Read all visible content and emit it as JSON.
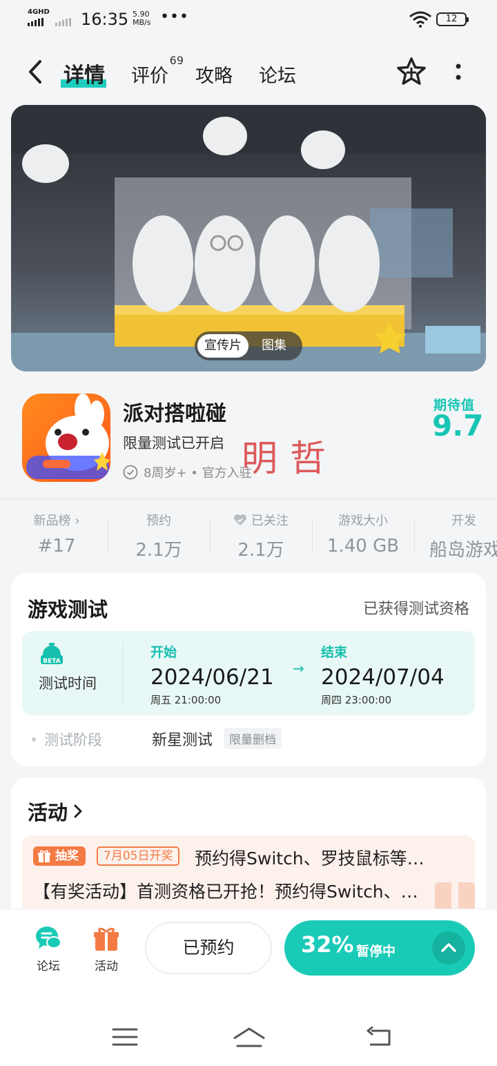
{
  "status_bar": {
    "network": "4GHD",
    "time": "16:35",
    "speed_value": "5.90",
    "speed_unit": "MB/s",
    "dots": "•••",
    "battery": "12"
  },
  "header": {
    "tabs": [
      {
        "label": "详情",
        "active": true
      },
      {
        "label": "评价",
        "badge": "69"
      },
      {
        "label": "攻略"
      },
      {
        "label": "论坛"
      }
    ]
  },
  "banner": {
    "toggle": [
      "宣传片",
      "图集"
    ]
  },
  "app": {
    "name": "派对搭啦碰",
    "subtitle": "限量测试已开启",
    "meta": "8周岁+ • 官方入驻",
    "stamp_text": "明哲",
    "expect_label": "期待值",
    "expect_value": "9.7"
  },
  "stats": [
    {
      "label": "新品榜 ›",
      "value": "#17"
    },
    {
      "label": "预约",
      "value": "2.1万"
    },
    {
      "label": "已关注",
      "value": "2.1万"
    },
    {
      "label": "游戏大小",
      "value": "1.40 GB"
    },
    {
      "label": "开发",
      "value": "船岛游戏"
    }
  ],
  "test": {
    "title": "游戏测试",
    "right": "已获得测试资格",
    "time_label": "测试时间",
    "beta": "BETA",
    "start_label": "开始",
    "start_date": "2024/06/21",
    "start_weekday": "周五  21:00:00",
    "end_label": "结束",
    "end_date": "2024/07/04",
    "end_weekday": "周四  23:00:00",
    "arrow": "→",
    "phase_label": "测试阶段",
    "phase_value": "新星测试",
    "phase_tag": "限量删档"
  },
  "activity": {
    "title": "活动",
    "lottery": "抽奖",
    "date_tag": "7月05日开奖",
    "line1": "预约得Switch、罗技鼠标等…",
    "line2": "【有奖活动】首测资格已开抢！预约得Switch、…"
  },
  "bottom": {
    "forum": "论坛",
    "activity": "活动",
    "reserved": "已预约",
    "progress": "32%",
    "progress_state": "暂停中"
  }
}
